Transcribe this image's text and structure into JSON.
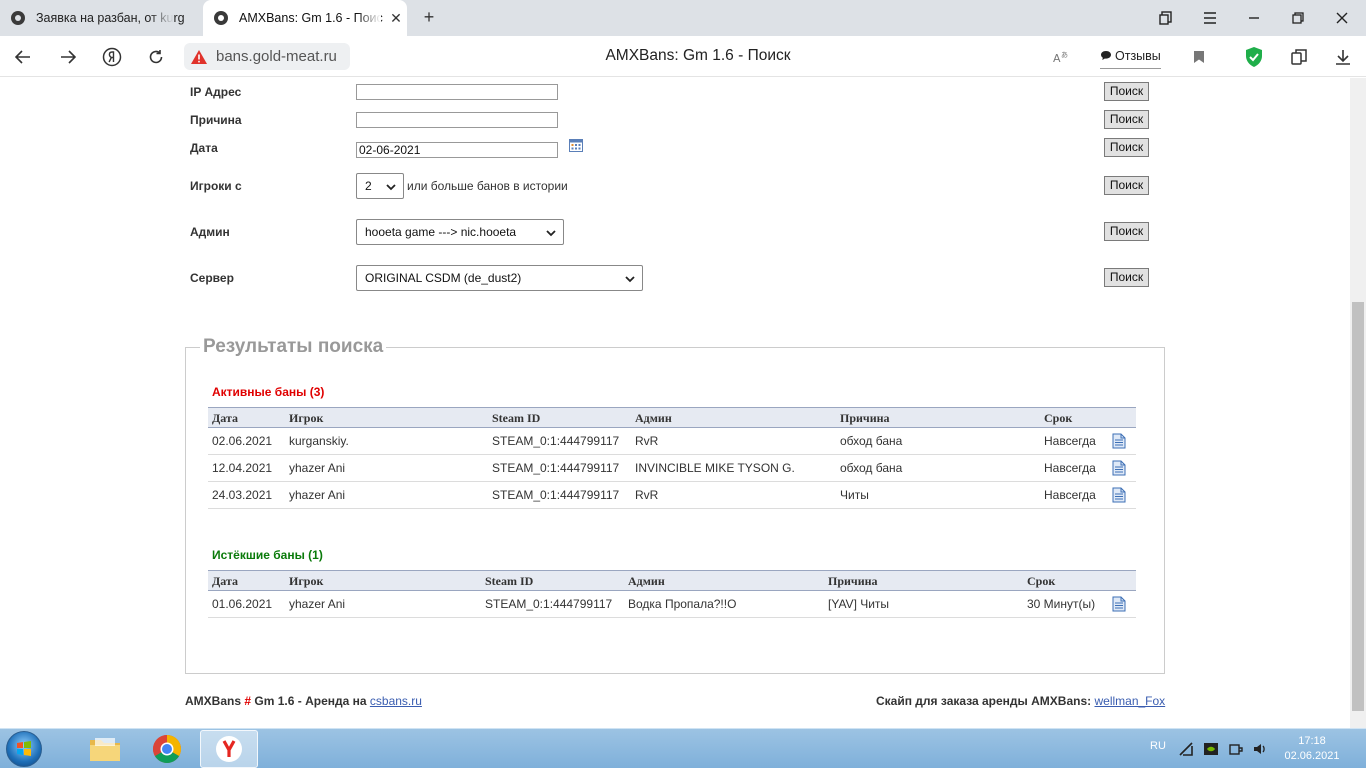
{
  "browser": {
    "tabs": [
      {
        "title": "Заявка на разбан, от kurg"
      },
      {
        "title": "AMXBans: Gm 1.6 - Поис"
      }
    ],
    "address_url": "bans.gold-meat.ru",
    "page_title": "AMXBans: Gm 1.6 - Поиск",
    "reviews_label": "Отзывы"
  },
  "search_form": {
    "ip": {
      "label": "IP Адрес",
      "value": ""
    },
    "reason": {
      "label": "Причина",
      "value": ""
    },
    "date": {
      "label": "Дата",
      "value": "02-06-2021"
    },
    "players": {
      "label": "Игроки с",
      "selected": "2",
      "hint": "или больше банов в истории"
    },
    "admin": {
      "label": "Админ",
      "selected": "hooeta game ---> nic.hooeta"
    },
    "server": {
      "label": "Сервер",
      "selected": "ORIGINAL CSDM (de_dust2)"
    },
    "search_button": "Поиск"
  },
  "results": {
    "legend": "Результаты поиска",
    "columns": [
      "Дата",
      "Игрок",
      "Steam ID",
      "Админ",
      "Причина",
      "Срок"
    ],
    "active": {
      "title": "Активные баны (3)",
      "color": "#e00000",
      "rows": [
        [
          "02.06.2021",
          "kurganskiy.",
          "STEAM_0:1:444799117",
          "RvR",
          "обход бана",
          "Навсегда"
        ],
        [
          "12.04.2021",
          "yhazer Ani",
          "STEAM_0:1:444799117",
          "INVINCIBLE MIKE TYSON G.",
          "обход бана",
          "Навсегда"
        ],
        [
          "24.03.2021",
          "yhazer Ani",
          "STEAM_0:1:444799117",
          "RvR",
          "Читы",
          "Навсегда"
        ]
      ]
    },
    "expired": {
      "title": "Истёкшие баны (1)",
      "color": "#0a7a0a",
      "rows": [
        [
          "01.06.2021",
          "yhazer Ani",
          "STEAM_0:1:444799117",
          "Водка Пропала?!!O",
          "[YAV] Читы",
          "30 Минут(ы)"
        ]
      ]
    }
  },
  "footer": {
    "left_brand": "AMXBans",
    "left_hash": "#",
    "left_text": "Gm 1.6 - Аренда на",
    "left_link": "csbans.ru",
    "right_text": "Скайп для заказа аренды AMXBans:",
    "right_link": "wellman_Fox"
  },
  "taskbar": {
    "lang": "RU",
    "time": "17:18",
    "date": "02.06.2021"
  }
}
